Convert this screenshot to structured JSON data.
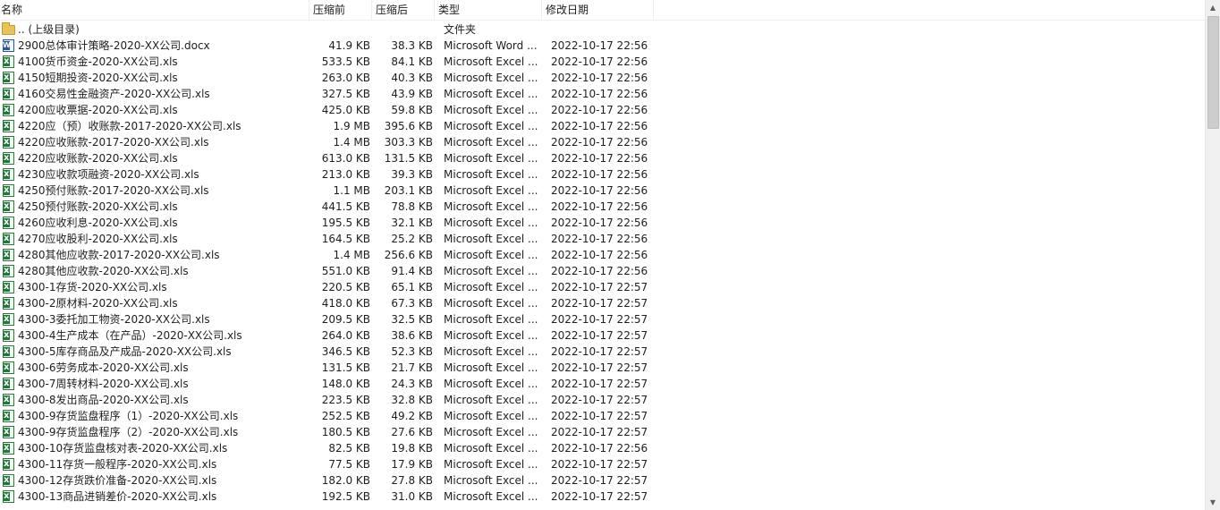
{
  "columns": {
    "name": "名称",
    "size": "压缩前",
    "packed": "压缩后",
    "type": "类型",
    "modified": "修改日期"
  },
  "parent": {
    "name": ".. (上级目录)",
    "type": "文件夹"
  },
  "files": [
    {
      "name": "2900总体审计策略-2020-XX公司.docx",
      "size": "41.9 KB",
      "packed": "38.3 KB",
      "type": "Microsoft Word ...",
      "modified": "2022-10-17 22:56",
      "icon": "word-doc-icon"
    },
    {
      "name": "4100货币资金-2020-XX公司.xls",
      "size": "533.5 KB",
      "packed": "84.1 KB",
      "type": "Microsoft Excel ...",
      "modified": "2022-10-17 22:56",
      "icon": "excel-file-icon"
    },
    {
      "name": "4150短期投资-2020-XX公司.xls",
      "size": "263.0 KB",
      "packed": "40.3 KB",
      "type": "Microsoft Excel ...",
      "modified": "2022-10-17 22:56",
      "icon": "excel-file-icon"
    },
    {
      "name": "4160交易性金融资产-2020-XX公司.xls",
      "size": "327.5 KB",
      "packed": "43.9 KB",
      "type": "Microsoft Excel ...",
      "modified": "2022-10-17 22:56",
      "icon": "excel-file-icon"
    },
    {
      "name": "4200应收票据-2020-XX公司.xls",
      "size": "425.0 KB",
      "packed": "59.8 KB",
      "type": "Microsoft Excel ...",
      "modified": "2022-10-17 22:56",
      "icon": "excel-file-icon"
    },
    {
      "name": "4220应（预）收账款-2017-2020-XX公司.xls",
      "size": "1.9 MB",
      "packed": "395.6 KB",
      "type": "Microsoft Excel ...",
      "modified": "2022-10-17 22:56",
      "icon": "excel-file-icon"
    },
    {
      "name": "4220应收账款-2017-2020-XX公司.xls",
      "size": "1.4 MB",
      "packed": "303.3 KB",
      "type": "Microsoft Excel ...",
      "modified": "2022-10-17 22:56",
      "icon": "excel-file-icon"
    },
    {
      "name": "4220应收账款-2020-XX公司.xls",
      "size": "613.0 KB",
      "packed": "131.5 KB",
      "type": "Microsoft Excel ...",
      "modified": "2022-10-17 22:56",
      "icon": "excel-file-icon"
    },
    {
      "name": "4230应收款项融资-2020-XX公司.xls",
      "size": "213.0 KB",
      "packed": "39.3 KB",
      "type": "Microsoft Excel ...",
      "modified": "2022-10-17 22:56",
      "icon": "excel-file-icon"
    },
    {
      "name": "4250预付账款-2017-2020-XX公司.xls",
      "size": "1.1 MB",
      "packed": "203.1 KB",
      "type": "Microsoft Excel ...",
      "modified": "2022-10-17 22:56",
      "icon": "excel-file-icon"
    },
    {
      "name": "4250预付账款-2020-XX公司.xls",
      "size": "441.5 KB",
      "packed": "78.8 KB",
      "type": "Microsoft Excel ...",
      "modified": "2022-10-17 22:56",
      "icon": "excel-file-icon"
    },
    {
      "name": "4260应收利息-2020-XX公司.xls",
      "size": "195.5 KB",
      "packed": "32.1 KB",
      "type": "Microsoft Excel ...",
      "modified": "2022-10-17 22:56",
      "icon": "excel-file-icon"
    },
    {
      "name": "4270应收股利-2020-XX公司.xls",
      "size": "164.5 KB",
      "packed": "25.2 KB",
      "type": "Microsoft Excel ...",
      "modified": "2022-10-17 22:56",
      "icon": "excel-file-icon"
    },
    {
      "name": "4280其他应收款-2017-2020-XX公司.xls",
      "size": "1.4 MB",
      "packed": "256.6 KB",
      "type": "Microsoft Excel ...",
      "modified": "2022-10-17 22:56",
      "icon": "excel-file-icon"
    },
    {
      "name": "4280其他应收款-2020-XX公司.xls",
      "size": "551.0 KB",
      "packed": "91.4 KB",
      "type": "Microsoft Excel ...",
      "modified": "2022-10-17 22:56",
      "icon": "excel-file-icon"
    },
    {
      "name": "4300-1存货-2020-XX公司.xls",
      "size": "220.5 KB",
      "packed": "65.1 KB",
      "type": "Microsoft Excel ...",
      "modified": "2022-10-17 22:57",
      "icon": "excel-file-icon"
    },
    {
      "name": "4300-2原材料-2020-XX公司.xls",
      "size": "418.0 KB",
      "packed": "67.3 KB",
      "type": "Microsoft Excel ...",
      "modified": "2022-10-17 22:57",
      "icon": "excel-file-icon"
    },
    {
      "name": "4300-3委托加工物资-2020-XX公司.xls",
      "size": "209.5 KB",
      "packed": "32.5 KB",
      "type": "Microsoft Excel ...",
      "modified": "2022-10-17 22:57",
      "icon": "excel-file-icon"
    },
    {
      "name": "4300-4生产成本（在产品）-2020-XX公司.xls",
      "size": "264.0 KB",
      "packed": "38.6 KB",
      "type": "Microsoft Excel ...",
      "modified": "2022-10-17 22:57",
      "icon": "excel-file-icon"
    },
    {
      "name": "4300-5库存商品及产成品-2020-XX公司.xls",
      "size": "346.5 KB",
      "packed": "52.3 KB",
      "type": "Microsoft Excel ...",
      "modified": "2022-10-17 22:57",
      "icon": "excel-file-icon"
    },
    {
      "name": "4300-6劳务成本-2020-XX公司.xls",
      "size": "131.5 KB",
      "packed": "21.7 KB",
      "type": "Microsoft Excel ...",
      "modified": "2022-10-17 22:57",
      "icon": "excel-file-icon"
    },
    {
      "name": "4300-7周转材料-2020-XX公司.xls",
      "size": "148.0 KB",
      "packed": "24.3 KB",
      "type": "Microsoft Excel ...",
      "modified": "2022-10-17 22:57",
      "icon": "excel-file-icon"
    },
    {
      "name": "4300-8发出商品-2020-XX公司.xls",
      "size": "223.5 KB",
      "packed": "32.8 KB",
      "type": "Microsoft Excel ...",
      "modified": "2022-10-17 22:57",
      "icon": "excel-file-icon"
    },
    {
      "name": "4300-9存货监盘程序（1）-2020-XX公司.xls",
      "size": "252.5 KB",
      "packed": "49.2 KB",
      "type": "Microsoft Excel ...",
      "modified": "2022-10-17 22:57",
      "icon": "excel-file-icon"
    },
    {
      "name": "4300-9存货监盘程序（2）-2020-XX公司.xls",
      "size": "180.5 KB",
      "packed": "27.6 KB",
      "type": "Microsoft Excel ...",
      "modified": "2022-10-17 22:57",
      "icon": "excel-file-icon"
    },
    {
      "name": "4300-10存货监盘核对表-2020-XX公司.xls",
      "size": "82.5 KB",
      "packed": "19.8 KB",
      "type": "Microsoft Excel ...",
      "modified": "2022-10-17 22:56",
      "icon": "excel-file-icon"
    },
    {
      "name": "4300-11存货一般程序-2020-XX公司.xls",
      "size": "77.5 KB",
      "packed": "17.9 KB",
      "type": "Microsoft Excel ...",
      "modified": "2022-10-17 22:57",
      "icon": "excel-file-icon"
    },
    {
      "name": "4300-12存货跌价准备-2020-XX公司.xls",
      "size": "182.0 KB",
      "packed": "27.8 KB",
      "type": "Microsoft Excel ...",
      "modified": "2022-10-17 22:57",
      "icon": "excel-file-icon"
    },
    {
      "name": "4300-13商品进销差价-2020-XX公司.xls",
      "size": "192.5 KB",
      "packed": "31.0 KB",
      "type": "Microsoft Excel ...",
      "modified": "2022-10-17 22:57",
      "icon": "excel-file-icon"
    }
  ]
}
